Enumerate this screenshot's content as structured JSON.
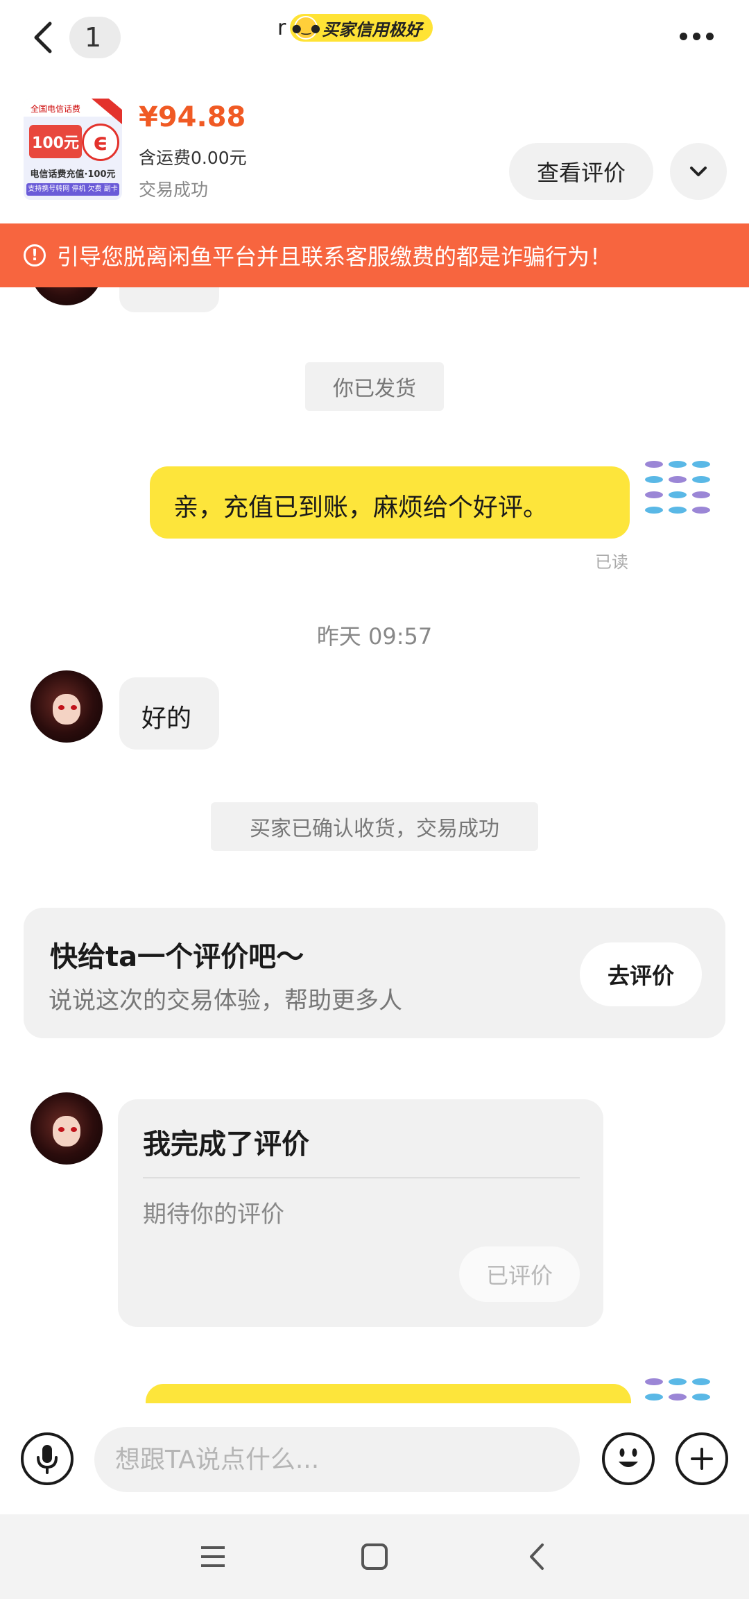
{
  "header": {
    "unread_count": "1",
    "partner_name": "r",
    "credit_badge": "买家信用极好"
  },
  "product": {
    "image_top": "全国电信话费",
    "image_big": "100元",
    "image_logo": "ϵ",
    "image_sub": "电信话费充值·100元",
    "image_foot": "支持携号转网 停机 欠费 副卡",
    "price": "¥94.88",
    "shipping": "含运费0.00元",
    "status": "交易成功",
    "view_review_label": "查看评价"
  },
  "warning": {
    "text": "引导您脱离闲鱼平台并且联系客服缴费的都是诈骗行为！"
  },
  "chat": {
    "system_shipped": "你已发货",
    "msg_self_1": "亲，充值已到账，麻烦给个好评。",
    "read_status": "已读",
    "timestamp": "昨天 09:57",
    "msg_other_1": "好的",
    "system_confirmed": "买家已确认收货，交易成功",
    "rate_card": {
      "title": "快给ta一个评价吧～",
      "subtitle": "说说这次的交易体验，帮助更多人",
      "button": "去评价"
    },
    "review_done_card": {
      "title": "我完成了评价",
      "subtitle": "期待你的评价",
      "button": "已评价"
    }
  },
  "input": {
    "placeholder": "想跟TA说点什么..."
  },
  "colors": {
    "accent_yellow": "#fde53b",
    "warning_orange": "#f7653f",
    "price_orange": "#f05a24"
  }
}
